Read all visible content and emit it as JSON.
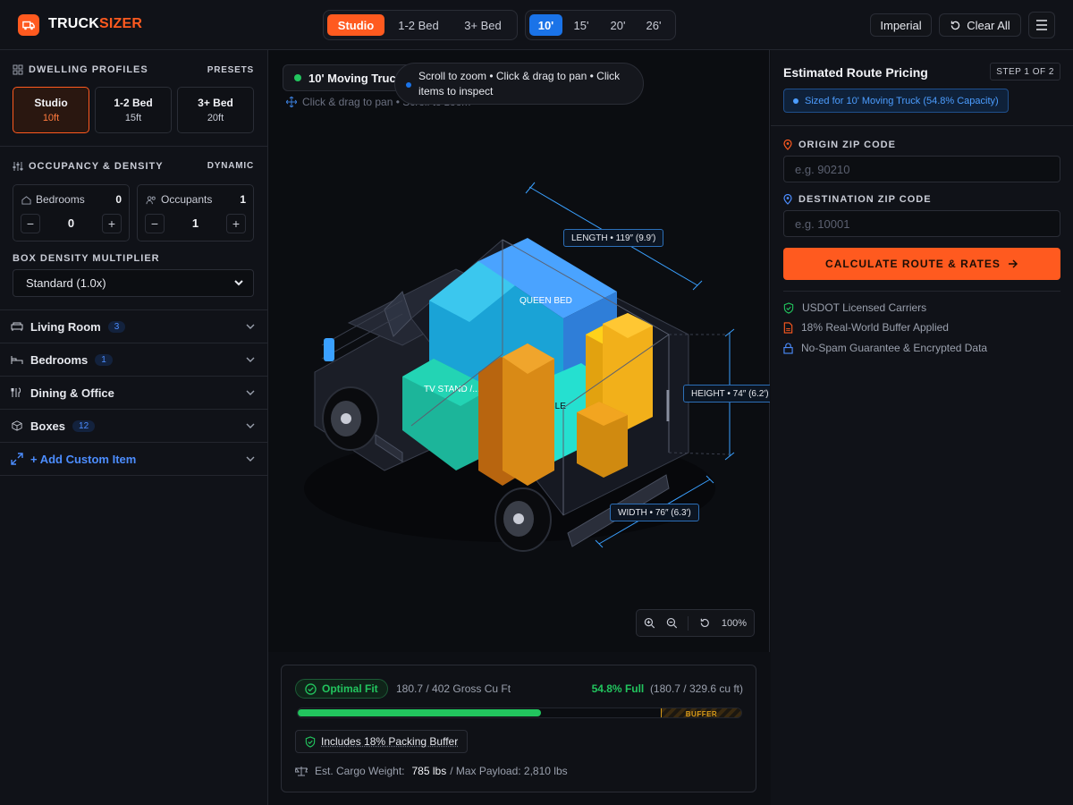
{
  "header": {
    "brand_a": "TRUCK",
    "brand_b": "SIZER",
    "dwelling_tabs": [
      "Studio",
      "1-2 Bed",
      "3+ Bed"
    ],
    "truck_tabs": [
      "10'",
      "15'",
      "20'",
      "26'"
    ],
    "units_label": "Imperial",
    "clear_label": "Clear All"
  },
  "sidebar": {
    "profiles_title": "DWELLING PROFILES",
    "presets_label": "PRESETS",
    "presets": [
      {
        "name": "Studio",
        "size": "10ft"
      },
      {
        "name": "1-2 Bed",
        "size": "15ft"
      },
      {
        "name": "3+ Bed",
        "size": "20ft"
      }
    ],
    "occupancy_title": "OCCUPANCY & DENSITY",
    "dynamic_label": "DYNAMIC",
    "bedrooms": {
      "label": "Bedrooms",
      "count": "0",
      "value": "0"
    },
    "occupants": {
      "label": "Occupants",
      "count": "1",
      "value": "1"
    },
    "density_label": "BOX DENSITY MULTIPLIER",
    "density_value": "Standard (1.0x)",
    "categories": [
      {
        "label": "Living Room",
        "count": "3"
      },
      {
        "label": "Bedrooms",
        "count": "1"
      },
      {
        "label": "Dining & Office",
        "count": ""
      },
      {
        "label": "Boxes",
        "count": "12"
      }
    ],
    "add_custom": "+ Add Custom Item"
  },
  "viewport": {
    "truck_label": "10' Moving Truck",
    "hint": "Click & drag to pan • Scroll to zoom",
    "tooltip": "Scroll to zoom • Click & drag to pan • Click items to inspect",
    "dim_length": "LENGTH • 119″ (9.9′)",
    "dim_height": "HEIGHT • 74″ (6.2′)",
    "dim_width": "WIDTH • 76″ (6.3′)",
    "item_queen": "QUEEN BED",
    "item_tv": "TV STAND /...",
    "item_table": "BLE",
    "zoom": "100%"
  },
  "stats": {
    "fit_label": "Optimal Fit",
    "gross": "180.7 / 402 Gross Cu Ft",
    "full_pct": "54.8% Full",
    "full_detail": "(180.7 / 329.6 cu ft)",
    "fill_fraction": 0.548,
    "buffer_label": "BUFFER",
    "buffer_pill": "Includes 18% Packing Buffer",
    "weight_label": "Est. Cargo Weight:",
    "weight_value": "785 lbs",
    "payload": "/ Max Payload: 2,810 lbs"
  },
  "pricing": {
    "title": "Estimated Route Pricing",
    "step": "STEP 1 OF 2",
    "sized": "Sized for 10' Moving Truck (54.8% Capacity)",
    "origin_label": "ORIGIN ZIP CODE",
    "origin_placeholder": "e.g. 90210",
    "dest_label": "DESTINATION ZIP CODE",
    "dest_placeholder": "e.g. 10001",
    "calc_label": "CALCULATE ROUTE & RATES",
    "trust": [
      "USDOT Licensed Carriers",
      "18% Real-World Buffer Applied",
      "No-Spam Guarantee & Encrypted Data"
    ]
  },
  "colors": {
    "accent": "#ff5a1f",
    "blue": "#1a73e8",
    "green": "#22c55e"
  }
}
